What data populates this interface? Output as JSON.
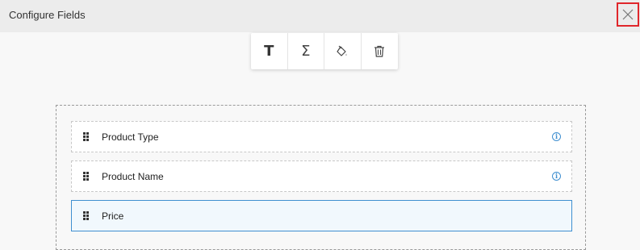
{
  "header": {
    "title": "Configure Fields"
  },
  "toolbar": {
    "tools": [
      {
        "icon": "text-format-icon",
        "glyph": "T"
      },
      {
        "icon": "sum-icon",
        "glyph": "Σ"
      },
      {
        "icon": "paint-bucket-icon"
      },
      {
        "icon": "trash-icon"
      }
    ]
  },
  "fields": [
    {
      "label": "Product Type",
      "has_info": true,
      "selected": false
    },
    {
      "label": "Product Name",
      "has_info": true,
      "selected": false
    },
    {
      "label": "Price",
      "has_info": false,
      "selected": true
    }
  ],
  "colors": {
    "accent": "#3f8fd0",
    "close_highlight": "#e0262b",
    "header_bg": "#ececec"
  }
}
